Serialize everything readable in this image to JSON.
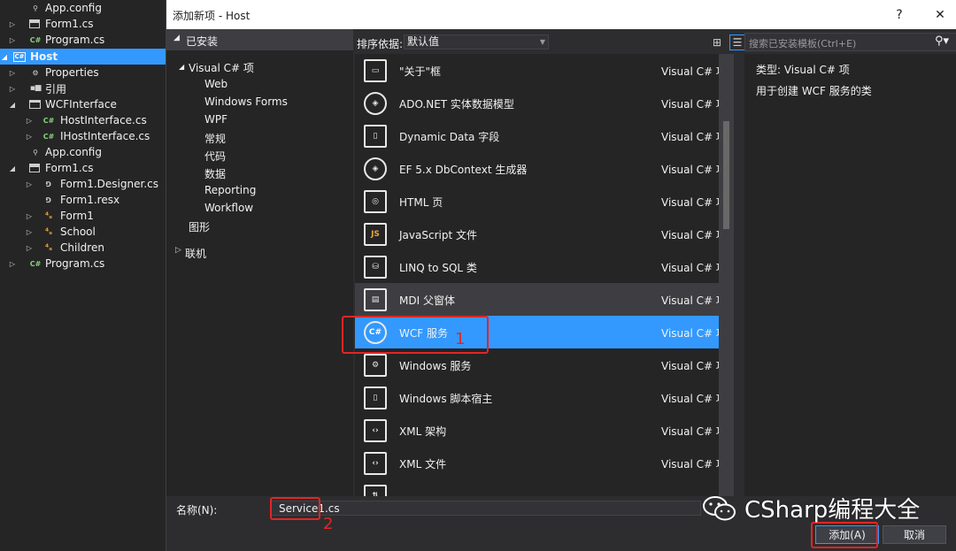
{
  "solution_explorer": {
    "items": [
      {
        "label": "App.config",
        "icon": "wrench-config-icon"
      },
      {
        "label": "Form1.cs",
        "icon": "form-icon"
      },
      {
        "label": "Program.cs",
        "icon": "csharp-file-icon"
      },
      {
        "label": "Host",
        "icon": "csharp-project-icon",
        "selected": true
      },
      {
        "label": "Properties",
        "icon": "wrench-icon"
      },
      {
        "label": "引用",
        "icon": "references-icon"
      },
      {
        "label": "WCFInterface",
        "icon": "folder-icon"
      },
      {
        "label": "HostInterface.cs",
        "icon": "csharp-file-icon"
      },
      {
        "label": "IHostInterface.cs",
        "icon": "csharp-file-icon"
      },
      {
        "label": "App.config",
        "icon": "wrench-config-icon"
      },
      {
        "label": "Form1.cs",
        "icon": "form-icon"
      },
      {
        "label": "Form1.Designer.cs",
        "icon": "designer-file-icon"
      },
      {
        "label": "Form1.resx",
        "icon": "resx-file-icon"
      },
      {
        "label": "Form1",
        "icon": "class-icon"
      },
      {
        "label": "School",
        "icon": "class-icon"
      },
      {
        "label": "Children",
        "icon": "class-icon"
      },
      {
        "label": "Program.cs",
        "icon": "csharp-file-icon"
      }
    ]
  },
  "dialog": {
    "title": "添加新项 - Host",
    "help_label": "?",
    "close_label": "✕",
    "categories": {
      "installed": "已安装",
      "visual_csharp": "Visual C# 项",
      "children": [
        "Web",
        "Windows Forms",
        "WPF",
        "常规",
        "代码",
        "数据",
        "Reporting",
        "Workflow"
      ],
      "graphics": "图形",
      "online": "联机"
    },
    "sort_label": "排序依据:",
    "sort_value": "默认值",
    "search_placeholder": "搜索已安装模板(Ctrl+E)",
    "templates": [
      {
        "name": "\"关于\"框",
        "type": "Visual C# 项",
        "icon": "about-box-icon"
      },
      {
        "name": "ADO.NET 实体数据模型",
        "type": "Visual C# 项",
        "icon": "entity-model-icon"
      },
      {
        "name": "Dynamic Data 字段",
        "type": "Visual C# 项",
        "icon": "dynamic-data-icon"
      },
      {
        "name": "EF 5.x DbContext 生成器",
        "type": "Visual C# 项",
        "icon": "dbcontext-icon"
      },
      {
        "name": "HTML 页",
        "type": "Visual C# 项",
        "icon": "html-page-icon"
      },
      {
        "name": "JavaScript 文件",
        "type": "Visual C# 项",
        "icon": "javascript-file-icon"
      },
      {
        "name": "LINQ to SQL 类",
        "type": "Visual C# 项",
        "icon": "linq-sql-icon"
      },
      {
        "name": "MDI 父窗体",
        "type": "Visual C# 项",
        "icon": "mdi-form-icon",
        "hover": true
      },
      {
        "name": "WCF 服务",
        "type": "Visual C# 项",
        "icon": "wcf-service-icon",
        "selected": true
      },
      {
        "name": "Windows 服务",
        "type": "Visual C# 项",
        "icon": "windows-service-icon"
      },
      {
        "name": "Windows 脚本宿主",
        "type": "Visual C# 项",
        "icon": "script-host-icon"
      },
      {
        "name": "XML 架构",
        "type": "Visual C# 项",
        "icon": "xml-schema-icon"
      },
      {
        "name": "XML 文件",
        "type": "Visual C# 项",
        "icon": "xml-file-icon"
      }
    ],
    "info": {
      "type_line": "类型:  Visual C# 项",
      "description": "用于创建 WCF 服务的类"
    },
    "name_label": "名称(N):",
    "name_value": "Service1.cs",
    "add_button": "添加(A)",
    "cancel_button": "取消"
  },
  "annotations": {
    "marker_1": "1",
    "marker_2": "2"
  },
  "watermark": "CSharp编程大全",
  "colors": {
    "selection": "#3399ff",
    "annotation_red": "#e32525",
    "dialog_bg": "#2d2d30",
    "pane_bg": "#252526"
  }
}
